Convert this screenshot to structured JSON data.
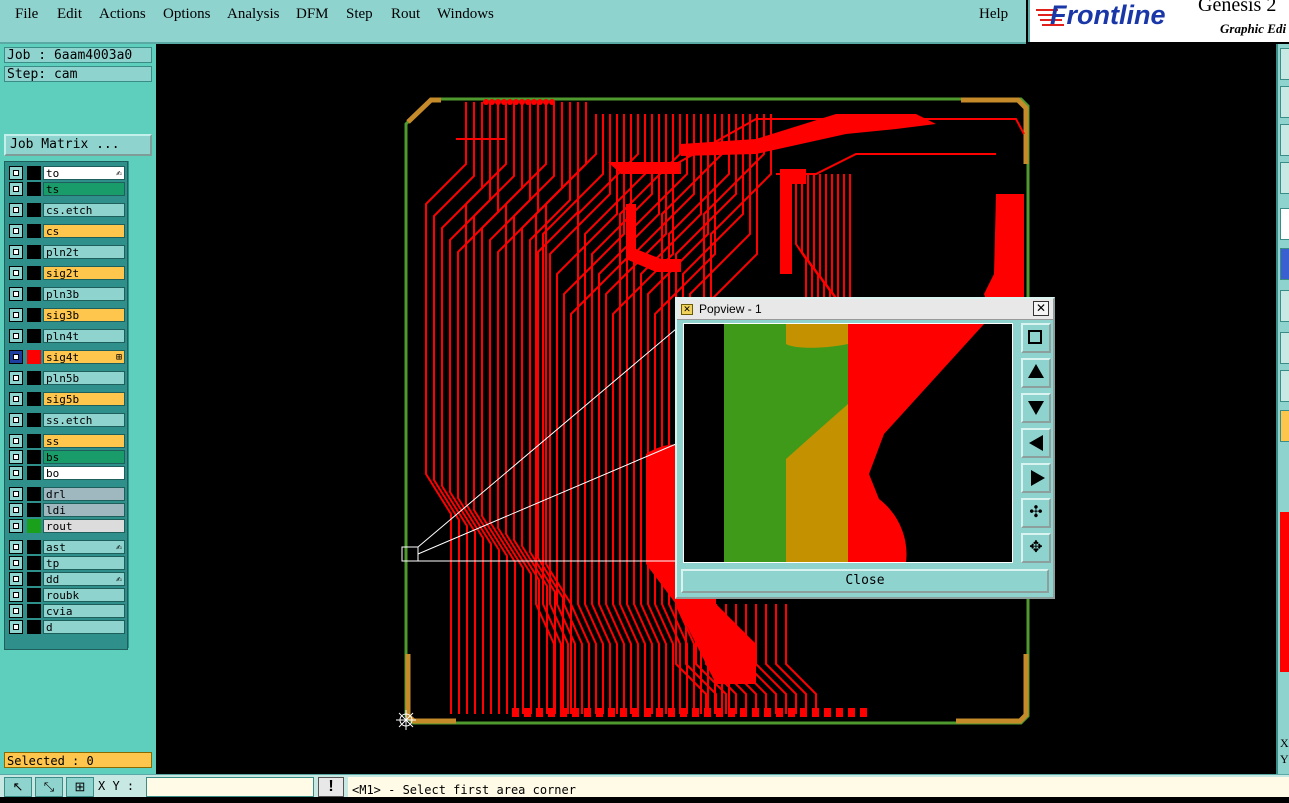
{
  "menu": {
    "items": [
      "File",
      "Edit",
      "Actions",
      "Options",
      "Analysis",
      "DFM",
      "Step",
      "Rout",
      "Windows"
    ],
    "help": "Help"
  },
  "brand": {
    "logo_text": "Frontline",
    "product": "Genesis 2",
    "subtitle": "Graphic Edi"
  },
  "job": {
    "job_line": "Job : 6aam4003a0",
    "step_line": "Step: cam",
    "matrix_button": "Job Matrix ..."
  },
  "layers": [
    {
      "name": "to",
      "color": "#ffffff",
      "mark": "#000000",
      "sym": "✍"
    },
    {
      "name": "ts",
      "color": "#1a9c6a",
      "mark": "#000000",
      "sym": ""
    },
    {
      "name": "cs.etch",
      "color": "#8fd3cf",
      "mark": "#000000",
      "sym": ""
    },
    {
      "name": "cs",
      "color": "#ffc64d",
      "mark": "#000000",
      "sym": ""
    },
    {
      "name": "pln2t",
      "color": "#8fd3cf",
      "mark": "#000000",
      "sym": ""
    },
    {
      "name": "sig2t",
      "color": "#ffc64d",
      "mark": "#000000",
      "sym": ""
    },
    {
      "name": "pln3b",
      "color": "#8fd3cf",
      "mark": "#000000",
      "sym": ""
    },
    {
      "name": "sig3b",
      "color": "#ffc64d",
      "mark": "#000000",
      "sym": ""
    },
    {
      "name": "pln4t",
      "color": "#8fd3cf",
      "mark": "#000000",
      "sym": ""
    },
    {
      "name": "sig4t",
      "color": "#ffc64d",
      "mark": "#ff0000",
      "sym": "⊞",
      "active": true
    },
    {
      "name": "pln5b",
      "color": "#8fd3cf",
      "mark": "#000000",
      "sym": ""
    },
    {
      "name": "sig5b",
      "color": "#ffc64d",
      "mark": "#000000",
      "sym": ""
    },
    {
      "name": "ss.etch",
      "color": "#8fd3cf",
      "mark": "#000000",
      "sym": ""
    },
    {
      "name": "ss",
      "color": "#ffc64d",
      "mark": "#000000",
      "sym": ""
    },
    {
      "name": "bs",
      "color": "#1a9c6a",
      "mark": "#000000",
      "sym": ""
    },
    {
      "name": "bo",
      "color": "#ffffff",
      "mark": "#000000",
      "sym": ""
    },
    {
      "name": "drl",
      "color": "#9fb8bf",
      "mark": "#000000",
      "sym": ""
    },
    {
      "name": "ldi",
      "color": "#9fb8bf",
      "mark": "#000000",
      "sym": ""
    },
    {
      "name": "rout",
      "color": "#dcdcdc",
      "mark": "#1aa01a",
      "sym": ""
    },
    {
      "name": "ast",
      "color": "#8fd3cf",
      "mark": "#000000",
      "sym": "✍"
    },
    {
      "name": "tp",
      "color": "#8fd3cf",
      "mark": "#000000",
      "sym": ""
    },
    {
      "name": "dd",
      "color": "#8fd3cf",
      "mark": "#000000",
      "sym": "✍"
    },
    {
      "name": "roubk",
      "color": "#8fd3cf",
      "mark": "#000000",
      "sym": ""
    },
    {
      "name": "cvia",
      "color": "#8fd3cf",
      "mark": "#000000",
      "sym": ""
    },
    {
      "name": "d",
      "color": "#8fd3cf",
      "mark": "#000000",
      "sym": ""
    }
  ],
  "status": {
    "selected": "Selected : 0",
    "xy_label": "X Y :",
    "xy_value": "",
    "prompt_mark": "!",
    "prompt": "<M1> - Select first area corner"
  },
  "popview": {
    "title": "Popview - 1",
    "close_button": "Close",
    "tools": [
      "zoom-fit-icon",
      "pan-up-icon",
      "pan-down-icon",
      "pan-left-icon",
      "pan-right-icon",
      "zoom-in-icon",
      "zoom-out-icon"
    ]
  },
  "right_edge": {
    "x_label": "X",
    "y_label": "Y"
  },
  "colors": {
    "board_outline": "#4f9a2e",
    "copper": "#ff0000",
    "panel_teal": "#5fcfbd",
    "menu_bg": "#8fd3cf",
    "highlight_orange": "#ffc64d"
  }
}
